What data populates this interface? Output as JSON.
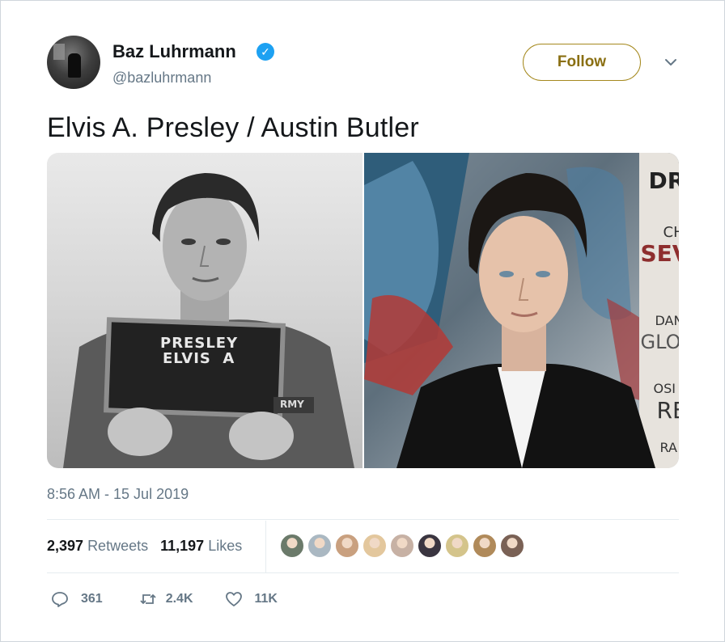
{
  "tweet": {
    "author": {
      "name": "Baz Luhrmann",
      "handle": "@bazluhrmann",
      "verified": true
    },
    "follow_label": "Follow",
    "text": "Elvis A. Presley / Austin Butler",
    "timestamp": "8:56 AM - 15 Jul 2019",
    "media": [
      {
        "name": "elvis-mugshot",
        "caption_lines": [
          "PRESLEY",
          "ELVIS  A"
        ],
        "patch_text": "RMY"
      },
      {
        "name": "austin-butler-photo",
        "backdrop_text": [
          "DR",
          "CH",
          "SEV",
          "DAN",
          "GLOV",
          "OSI",
          "RE",
          "RA"
        ]
      }
    ],
    "stats": {
      "retweets_count": "2,397",
      "retweets_label": "Retweets",
      "likes_count": "11,197",
      "likes_label": "Likes"
    },
    "liker_avatar_colors": [
      "#6b7a6a",
      "#aab8c2",
      "#c9a07f",
      "#e3c79d",
      "#c7b1a4",
      "#3a3540",
      "#d4c48b",
      "#b08a5a",
      "#7a6155"
    ],
    "actions": {
      "replies": "361",
      "retweets": "2.4K",
      "likes": "11K"
    },
    "colors": {
      "follow_accent": "#a5891e",
      "verified_blue": "#1da1f2",
      "secondary_text": "#657786"
    }
  }
}
